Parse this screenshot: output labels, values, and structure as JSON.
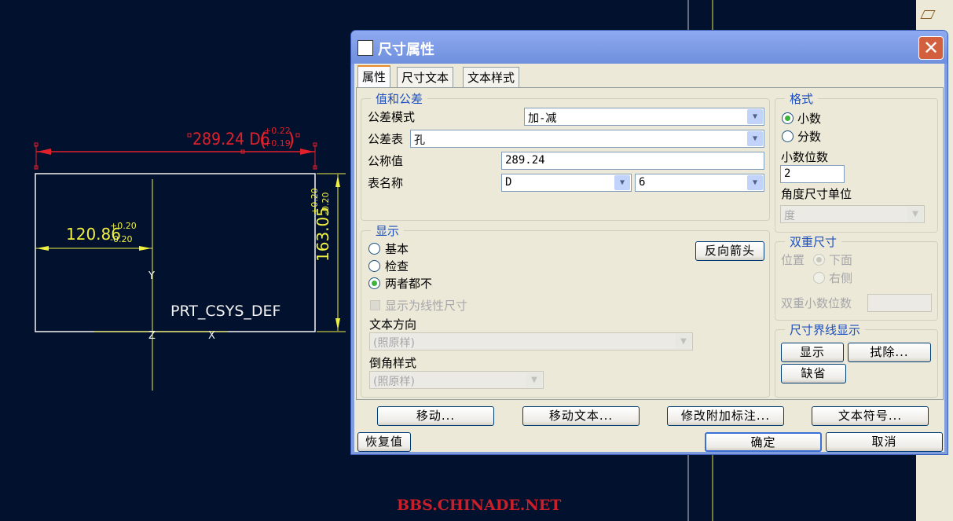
{
  "cad": {
    "dim_top": "289.24 D6",
    "dim_top_upper": "+0.22",
    "dim_top_lower": "+0.19",
    "dim_left": "120.86",
    "dim_left_upper": "+0.20",
    "dim_left_lower": "-0.20",
    "dim_right": "163.05",
    "dim_right_upper": "+0.20",
    "dim_right_lower": "-0.20",
    "csys": "PRT_CSYS_DEF",
    "axis_y": "Y",
    "axis_z": "Z",
    "axis_x": "X",
    "highlight_color": "#e0202a",
    "dim_color": "#f0f040"
  },
  "watermark": "BBS.CHINADE.NET",
  "dialog": {
    "title": "尺寸属性",
    "close": "✕",
    "tabs": [
      {
        "label": "属性",
        "active": true
      },
      {
        "label": "尺寸文本"
      },
      {
        "label": "文本样式"
      }
    ],
    "value_tol": {
      "legend": "值和公差",
      "tol_mode_label": "公差模式",
      "tol_mode": "加-减",
      "tol_table_label": "公差表",
      "tol_table": "孔",
      "nominal_label": "公称值",
      "nominal": "289.24",
      "table_name_label": "表名称",
      "table_name": "D",
      "table_grade": "6"
    },
    "format": {
      "legend": "格式",
      "decimal": "小数",
      "fraction": "分数",
      "selected": "小数",
      "decimal_places_label": "小数位数",
      "decimal_places": "2",
      "angle_unit_label": "角度尺寸单位",
      "angle_unit": "度"
    },
    "display": {
      "legend": "显示",
      "basic": "基本",
      "inspection": "检查",
      "neither": "两者都不",
      "selected": "两者都不",
      "flip_arrows": "反向箭头",
      "show_linear": "显示为线性尺寸",
      "text_orient_label": "文本方向",
      "text_orient": "(照原样)",
      "chamfer_label": "倒角样式",
      "chamfer": "(照原样)"
    },
    "dual": {
      "legend": "双重尺寸",
      "position_label": "位置",
      "below": "下面",
      "right": "右侧",
      "dual_decimals_label": "双重小数位数",
      "dual_decimals": ""
    },
    "witness": {
      "legend": "尺寸界线显示",
      "show": "显示",
      "erase": "拭除...",
      "default": "缺省"
    },
    "actions": {
      "move": "移动...",
      "move_text": "移动文本...",
      "edit_attach": "修改附加标注...",
      "text_symbol": "文本符号..."
    },
    "footer": {
      "restore": "恢复值",
      "ok": "确定",
      "cancel": "取消"
    }
  }
}
